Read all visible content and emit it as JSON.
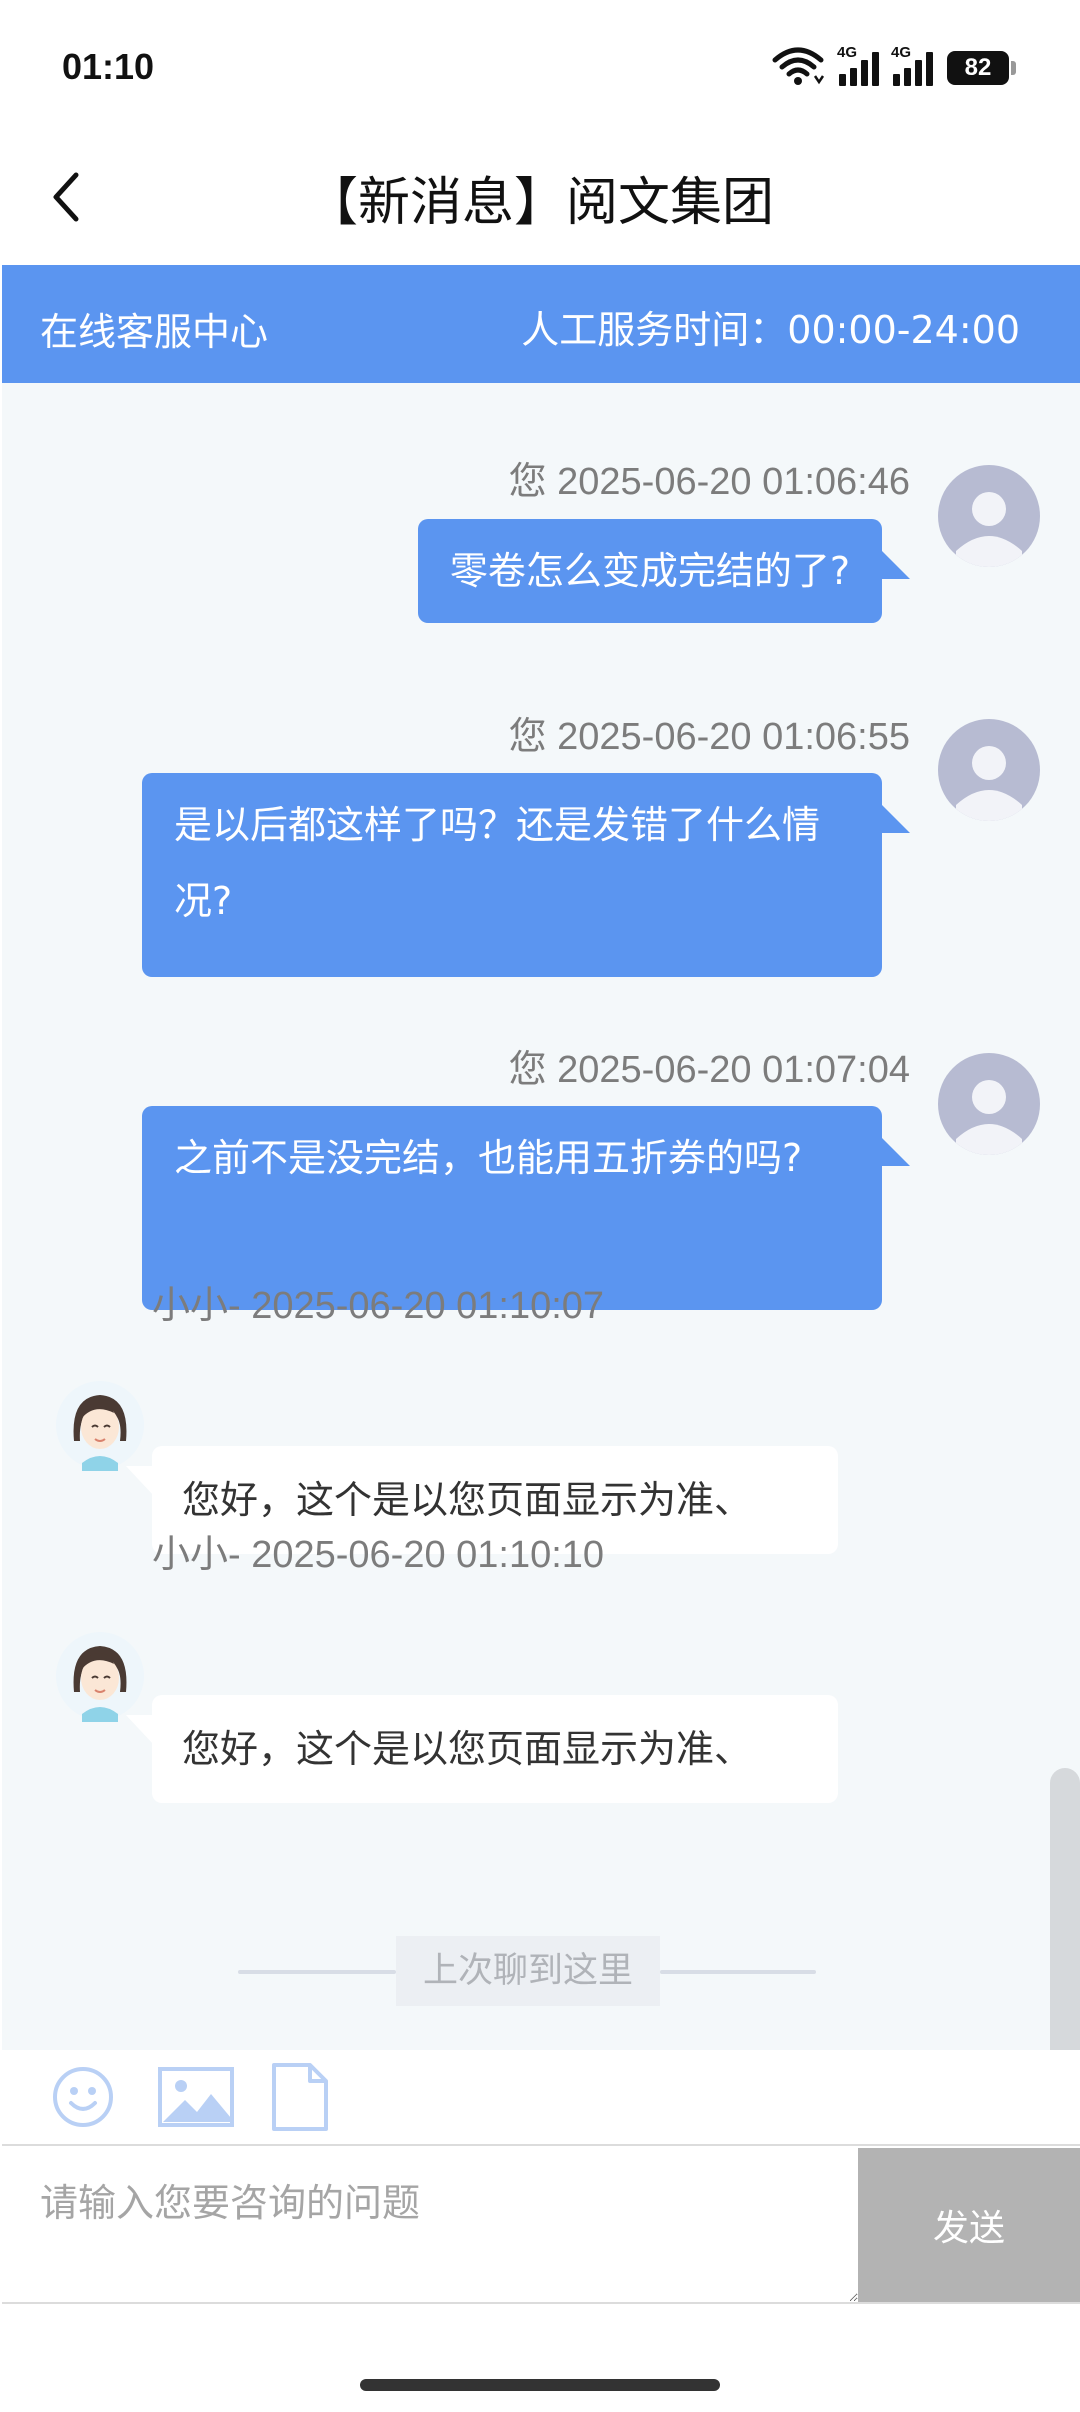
{
  "status_bar": {
    "time": "01:10",
    "network_1": "4G",
    "network_2": "4G",
    "battery": "82"
  },
  "header": {
    "title": "【新消息】阅文集团"
  },
  "service": {
    "name": "在线客服中心",
    "hours": "人工服务时间：00:00-24:00"
  },
  "messages": [
    {
      "sender": "user",
      "time": "您 2025-06-20 01:06:46",
      "text": "零卷怎么变成完结的了?"
    },
    {
      "sender": "user",
      "time": "您 2025-06-20 01:06:55",
      "text": "是以后都这样了吗？还是发错了什么情况?"
    },
    {
      "sender": "user",
      "time": "您 2025-06-20 01:07:04",
      "text": "之前不是没完结，也能用五折券的吗?"
    },
    {
      "sender": "agent",
      "time": "小小- 2025-06-20 01:10:07",
      "text": "您好，这个是以您页面显示为准、"
    },
    {
      "sender": "agent",
      "time": "小小- 2025-06-20 01:10:10",
      "text": "您好，这个是以您页面显示为准、"
    }
  ],
  "divider": {
    "label": "上次聊到这里"
  },
  "toolbar": {
    "icons": [
      "emoji-icon",
      "image-icon",
      "file-icon"
    ]
  },
  "input": {
    "placeholder": "请输入您要咨询的问题",
    "value": ""
  },
  "send_label": "发送",
  "colors": {
    "accent": "#5b95f0",
    "chat_bg": "#f4f8fa",
    "send_disabled": "#b3b3b3"
  }
}
